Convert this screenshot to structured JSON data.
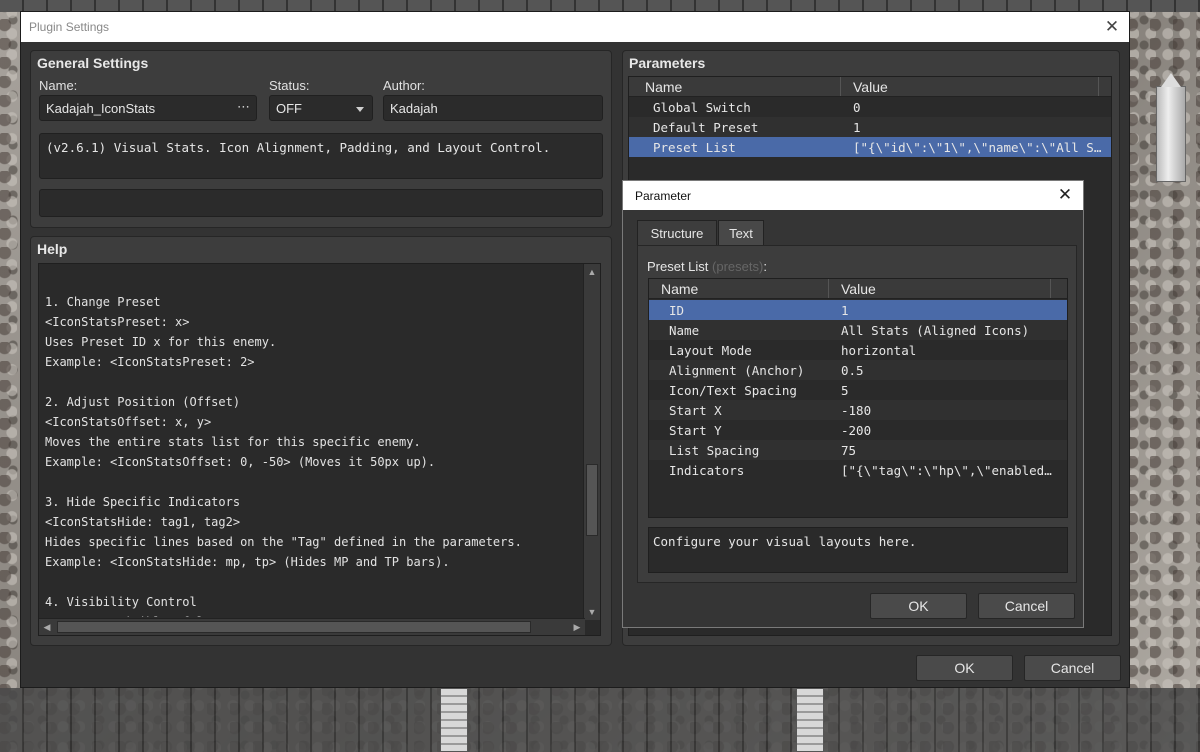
{
  "main_window": {
    "title": "Plugin Settings",
    "ok_label": "OK",
    "cancel_label": "Cancel"
  },
  "general": {
    "heading": "General Settings",
    "name_label": "Name:",
    "name_value": "Kadajah_IconStats",
    "name_ellipsis": "⋯",
    "status_label": "Status:",
    "status_value": "OFF",
    "author_label": "Author:",
    "author_value": "Kadajah",
    "description": "(v2.6.1) Visual Stats. Icon Alignment, Padding, and Layout Control.",
    "extra": ""
  },
  "help": {
    "heading": "Help",
    "lines": [
      "",
      "1. Change Preset",
      "<IconStatsPreset: x>",
      "Uses Preset ID x for this enemy.",
      "Example: <IconStatsPreset: 2>",
      "",
      "2. Adjust Position (Offset)",
      "<IconStatsOffset: x, y>",
      "Moves the entire stats list for this specific enemy.",
      "Example: <IconStatsOffset: 0, -50> (Moves it 50px up).",
      "",
      "3. Hide Specific Indicators",
      "<IconStatsHide: tag1, tag2>",
      "Hides specific lines based on the \"Tag\" defined in the parameters.",
      "Example: <IconStatsHide: mp, tp> (Hides MP and TP bars).",
      "",
      "4. Visibility Control",
      "<IconStatsVisible: false>"
    ]
  },
  "parameters": {
    "heading": "Parameters",
    "col_name": "Name",
    "col_value": "Value",
    "rows": [
      {
        "name": "Global Switch",
        "value": "0"
      },
      {
        "name": "Default Preset",
        "value": "1"
      },
      {
        "name": "Preset List",
        "value": "[\"{\\\"id\\\":\\\"1\\\",\\\"name\\\":\\\"All S…"
      }
    ],
    "selected_index": 2
  },
  "dialog": {
    "title": "Parameter",
    "tabs": [
      "Structure",
      "Text"
    ],
    "active_tab": "Structure",
    "list_label": "Preset List",
    "list_type": "(presets)",
    "list_colon": ":",
    "col_name": "Name",
    "col_value": "Value",
    "rows": [
      {
        "name": "ID",
        "value": "1"
      },
      {
        "name": "Name",
        "value": "All Stats (Aligned Icons)"
      },
      {
        "name": "Layout Mode",
        "value": "horizontal"
      },
      {
        "name": "Alignment (Anchor)",
        "value": "0.5"
      },
      {
        "name": "Icon/Text Spacing",
        "value": "5"
      },
      {
        "name": "Start X",
        "value": "-180"
      },
      {
        "name": "Start Y",
        "value": "-200"
      },
      {
        "name": "List Spacing",
        "value": "75"
      },
      {
        "name": "Indicators",
        "value": "[\"{\\\"tag\\\":\\\"hp\\\",\\\"enabled…"
      }
    ],
    "selected_index": 0,
    "description": "Configure your visual layouts here.",
    "ok_label": "OK",
    "cancel_label": "Cancel"
  }
}
